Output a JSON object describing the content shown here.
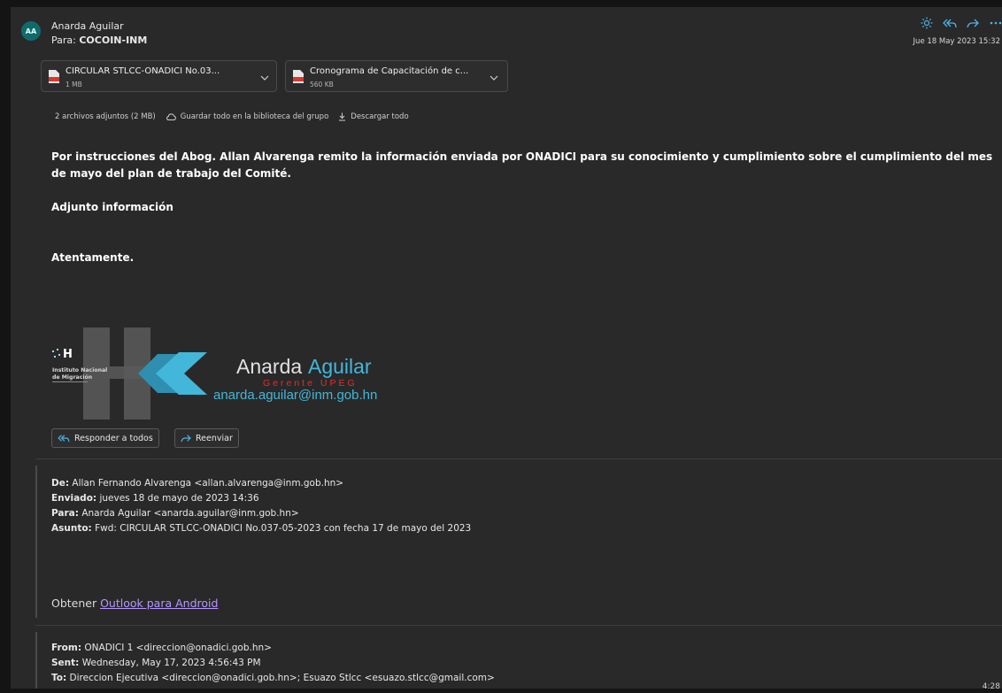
{
  "email": {
    "avatar_initials": "AA",
    "sender": "Anarda Aguilar",
    "to_prefix": "Para:",
    "to_value": "COCOIN-INM",
    "date": "Jue 18 May 2023 15:32"
  },
  "attachments": [
    {
      "name": "CIRCULAR STLCC-ONADICI No.03...",
      "size": "1 MB",
      "icon": "pdf-icon"
    },
    {
      "name": "Cronograma de Capacitación de c...",
      "size": "560 KB",
      "icon": "pdf-icon"
    }
  ],
  "attachments_info": {
    "count": "2 archivos adjuntos (2 MB)",
    "save_all": "Guardar todo en la biblioteca del grupo",
    "download_all": "Descargar todo"
  },
  "body": {
    "p1": "Por instrucciones del Abog. Allan Alvarenga remito la información enviada por ONADICI para su conocimiento y cumplimiento sobre el cumplimiento del mes de mayo del plan de trabajo del Comité.",
    "p2": "Adjunto información",
    "p3": "Atentamente."
  },
  "signature": {
    "logo_text_1": "Instituto Nacional",
    "logo_text_2": "de Migración",
    "first_name": "Anarda",
    "last_name": "Aguilar",
    "role": "Gerente UPEG",
    "email": "anarda.aguilar@inm.gob.hn"
  },
  "buttons": {
    "reply_all": "Responder a todos",
    "forward": "Reenviar"
  },
  "forwarded": {
    "from_label": "De:",
    "from_value": "Allan Fernando Alvarenga <allan.alvarenga@inm.gob.hn>",
    "sent_label": "Enviado:",
    "sent_value": "jueves 18 de mayo de 2023 14:36",
    "to_label": "Para:",
    "to_value": "Anarda Aguilar <anarda.aguilar@inm.gob.hn>",
    "subject_label": "Asunto:",
    "subject_value": "Fwd: CIRCULAR STLCC-ONADICI No.037-05-2023 con fecha 17 de mayo del 2023"
  },
  "get_outlook": {
    "prefix": "Obtener ",
    "link": "Outlook para Android"
  },
  "original": {
    "from_label": "From:",
    "from_value": "ONADICI 1 <direccion@onadici.gob.hn>",
    "sent_label": "Sent:",
    "sent_value": "Wednesday, May 17, 2023 4:56:43 PM",
    "to_label": "To:",
    "to_value": "Direccion Ejecutiva <direccion@onadici.gob.hn>; Esuazo Stlcc <esuazo.stlcc@gmail.com>"
  },
  "taskbar_time": "4:28",
  "colors": {
    "accent": "#4fb3e8",
    "link": "#b696ff",
    "background": "#292929",
    "signature_red": "#e03030",
    "signature_blue": "#43b7d9"
  }
}
